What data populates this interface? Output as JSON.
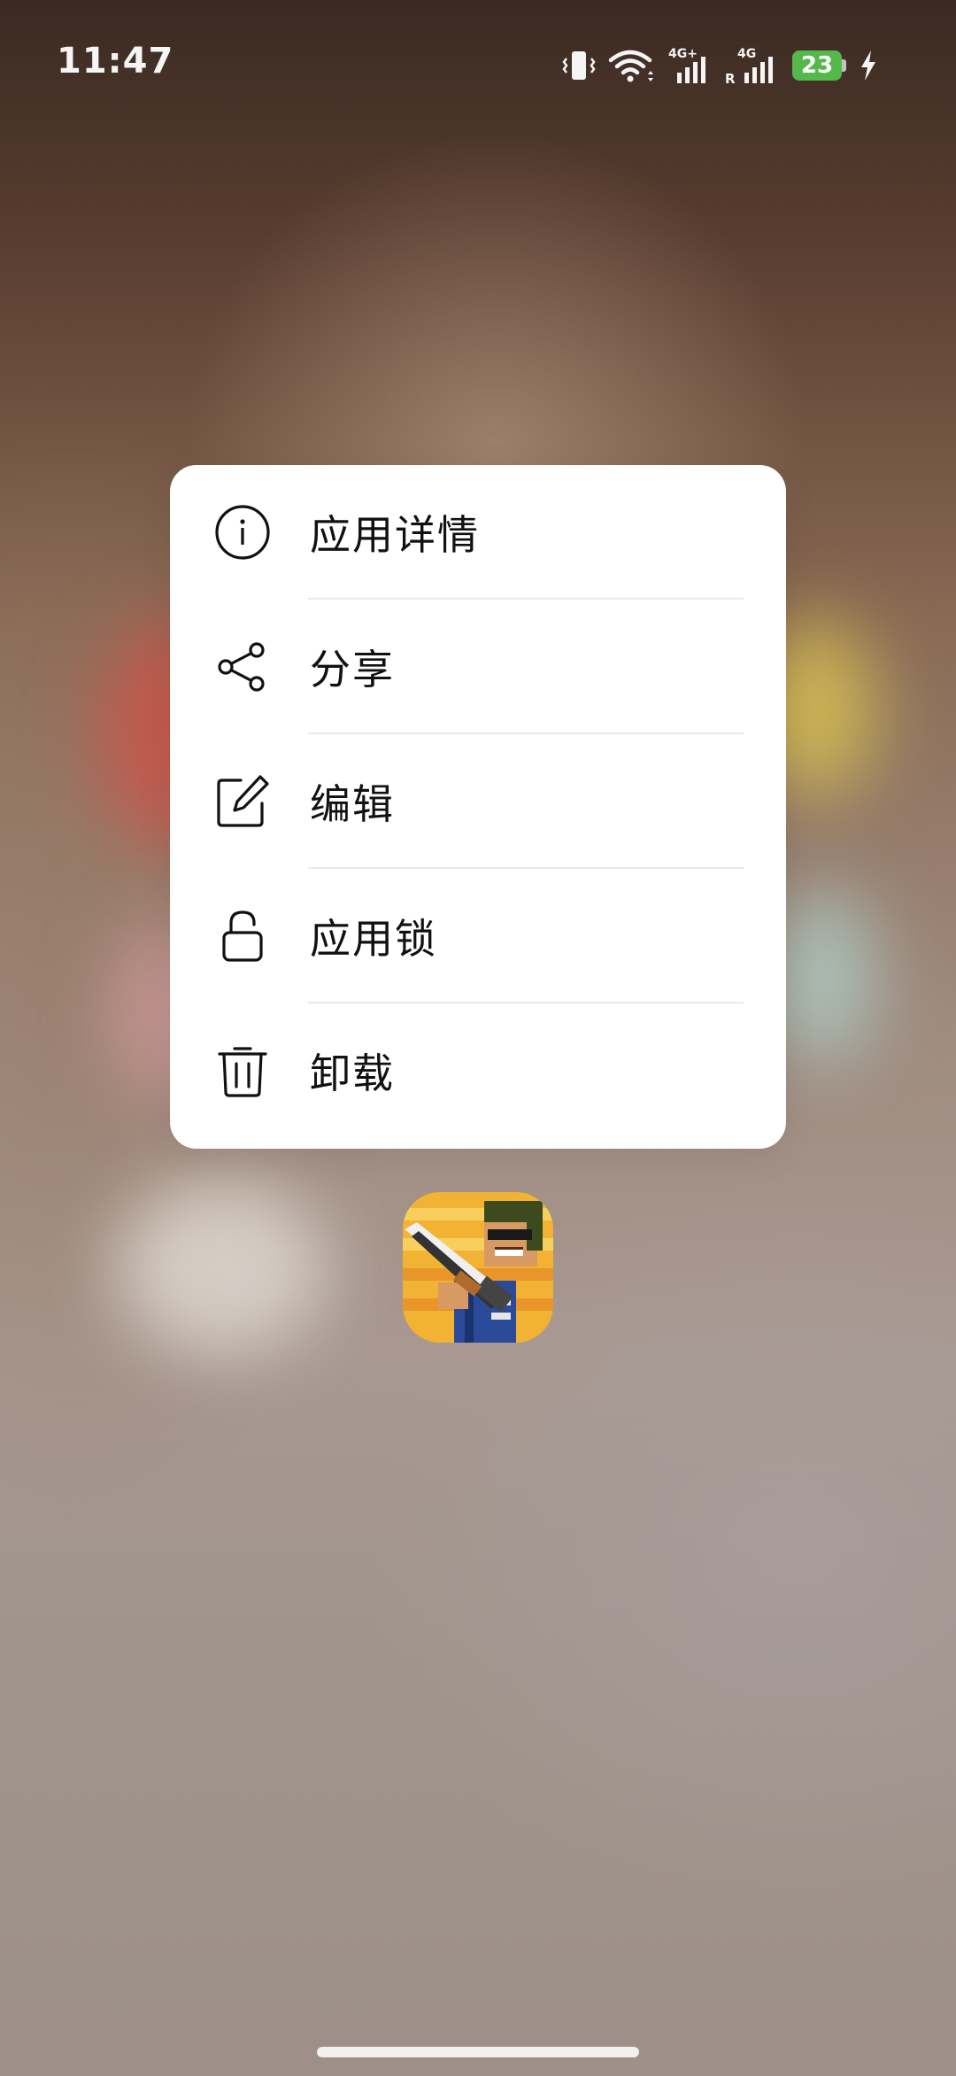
{
  "status_bar": {
    "time": "11:47",
    "battery_level": "23",
    "network_1": "4G+",
    "network_2": "4G",
    "roaming": "R"
  },
  "menu": {
    "items": [
      {
        "label": "应用详情",
        "icon": "info-icon"
      },
      {
        "label": "分享",
        "icon": "share-icon"
      },
      {
        "label": "编辑",
        "icon": "edit-icon"
      },
      {
        "label": "应用锁",
        "icon": "lock-icon"
      },
      {
        "label": "卸载",
        "icon": "trash-icon"
      }
    ]
  },
  "app": {
    "icon": "pixel-game-app-icon"
  },
  "colors": {
    "battery": "#55b84a",
    "menu_background": "#ffffff"
  }
}
